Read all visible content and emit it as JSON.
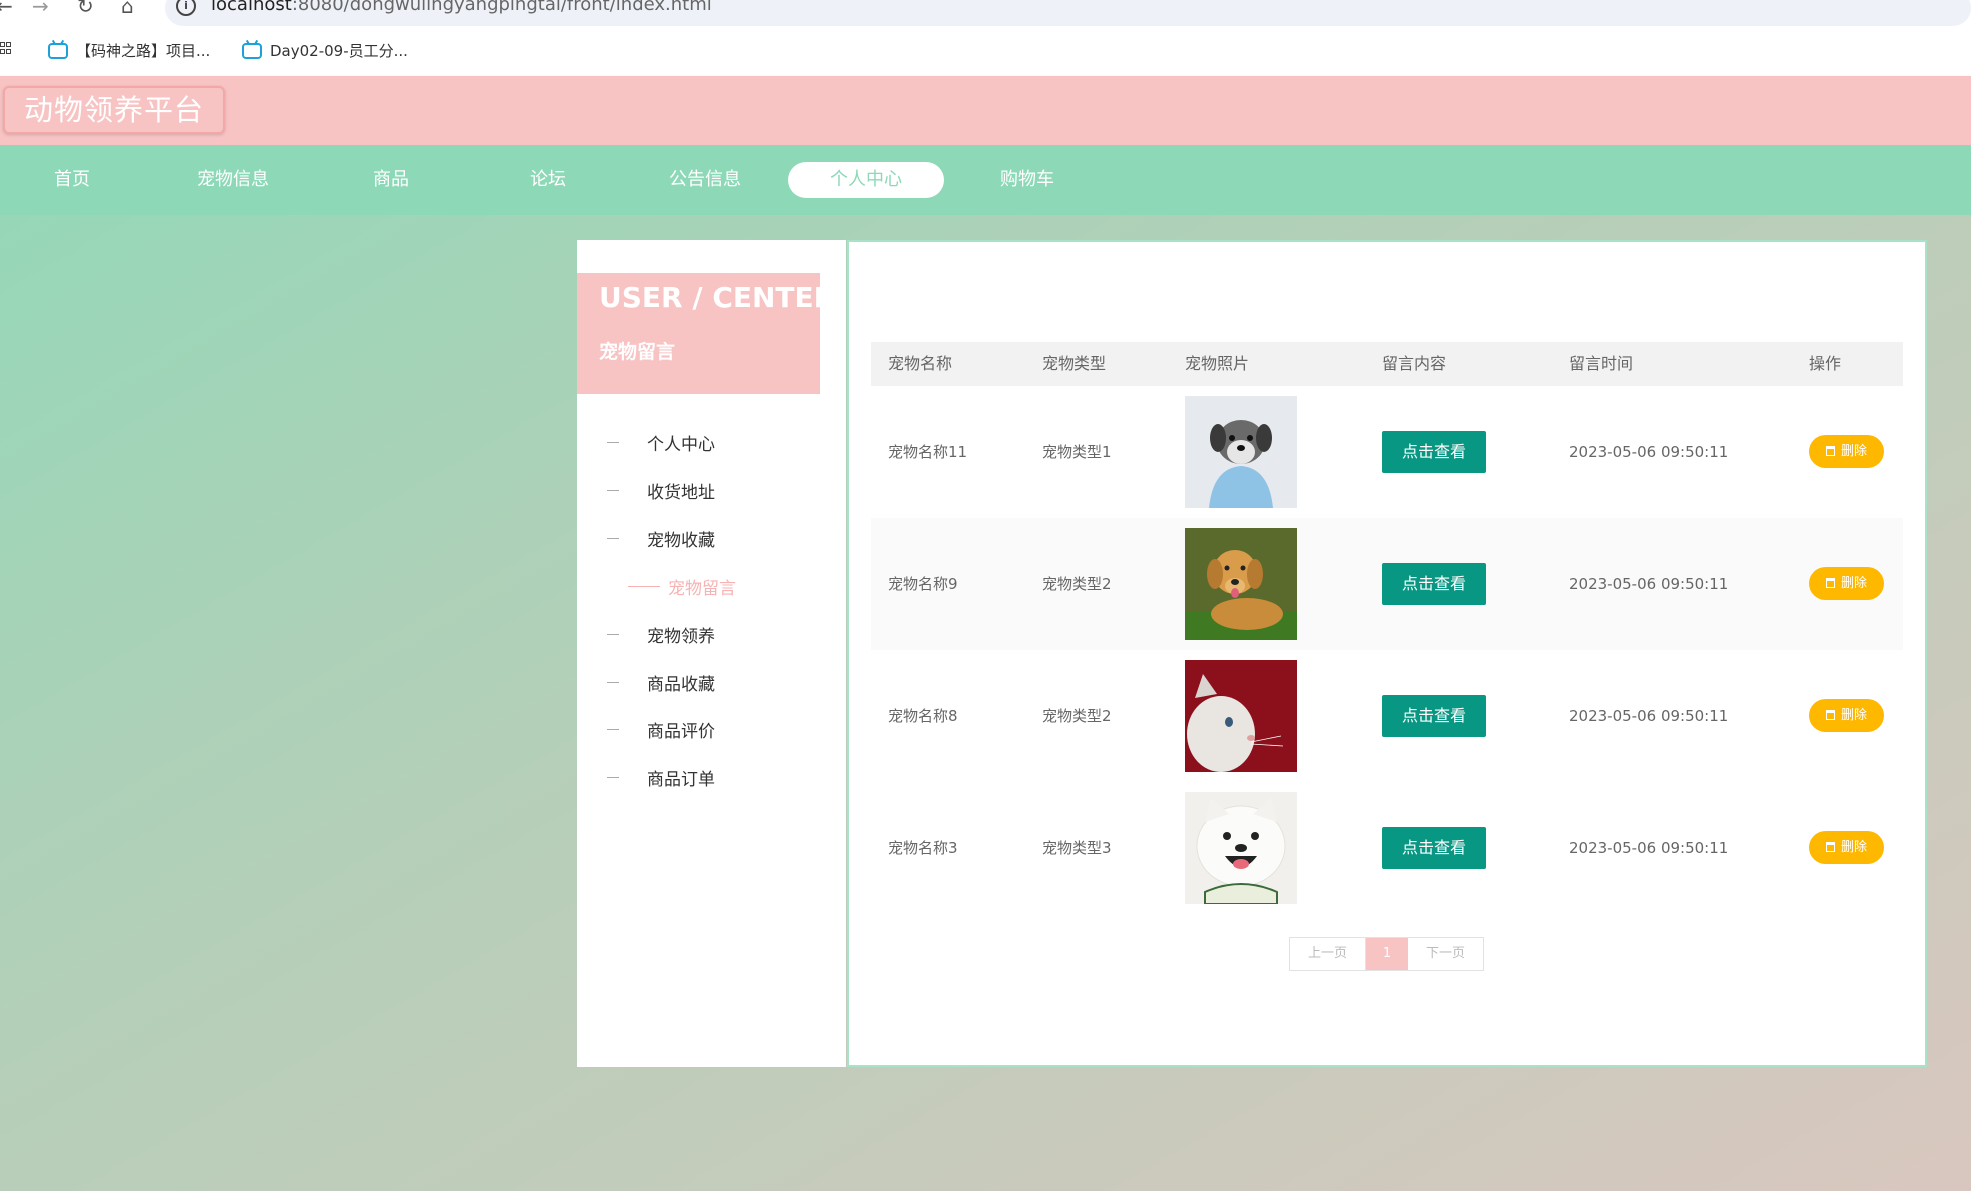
{
  "browser": {
    "url_host": "localhost",
    "url_rest": ":8080/dongwulingyangpingtai/front/index.html",
    "bookmarks": [
      {
        "label": "【码神之路】项目..."
      },
      {
        "label": "Day02-09-员工分..."
      }
    ]
  },
  "site": {
    "title": "动物领养平台",
    "nav": [
      {
        "label": "首页"
      },
      {
        "label": "宠物信息"
      },
      {
        "label": "商品"
      },
      {
        "label": "论坛"
      },
      {
        "label": "公告信息"
      },
      {
        "label": "个人中心"
      },
      {
        "label": "购物车"
      }
    ]
  },
  "sidebar": {
    "title_en": "USER / CENTER",
    "title_cn": "宠物留言",
    "items": [
      {
        "label": "个人中心"
      },
      {
        "label": "收货地址"
      },
      {
        "label": "宠物收藏"
      },
      {
        "label": "宠物留言"
      },
      {
        "label": "宠物领养"
      },
      {
        "label": "商品收藏"
      },
      {
        "label": "商品评价"
      },
      {
        "label": "商品订单"
      }
    ]
  },
  "table": {
    "headers": [
      "宠物名称",
      "宠物类型",
      "宠物照片",
      "留言内容",
      "留言时间",
      "操作"
    ],
    "view_label": "点击查看",
    "delete_label": "删除",
    "rows": [
      {
        "name": "宠物名称11",
        "type": "宠物类型1",
        "time": "2023-05-06 09:50:11"
      },
      {
        "name": "宠物名称9",
        "type": "宠物类型2",
        "time": "2023-05-06 09:50:11"
      },
      {
        "name": "宠物名称8",
        "type": "宠物类型2",
        "time": "2023-05-06 09:50:11"
      },
      {
        "name": "宠物名称3",
        "type": "宠物类型3",
        "time": "2023-05-06 09:50:11"
      }
    ]
  },
  "pager": {
    "prev": "上一页",
    "current": "1",
    "next": "下一页"
  },
  "colors": {
    "header_pink": "#f7c3c3",
    "nav_green": "#8dd9b7",
    "view_button": "#079783",
    "delete_button": "#ffb800"
  }
}
